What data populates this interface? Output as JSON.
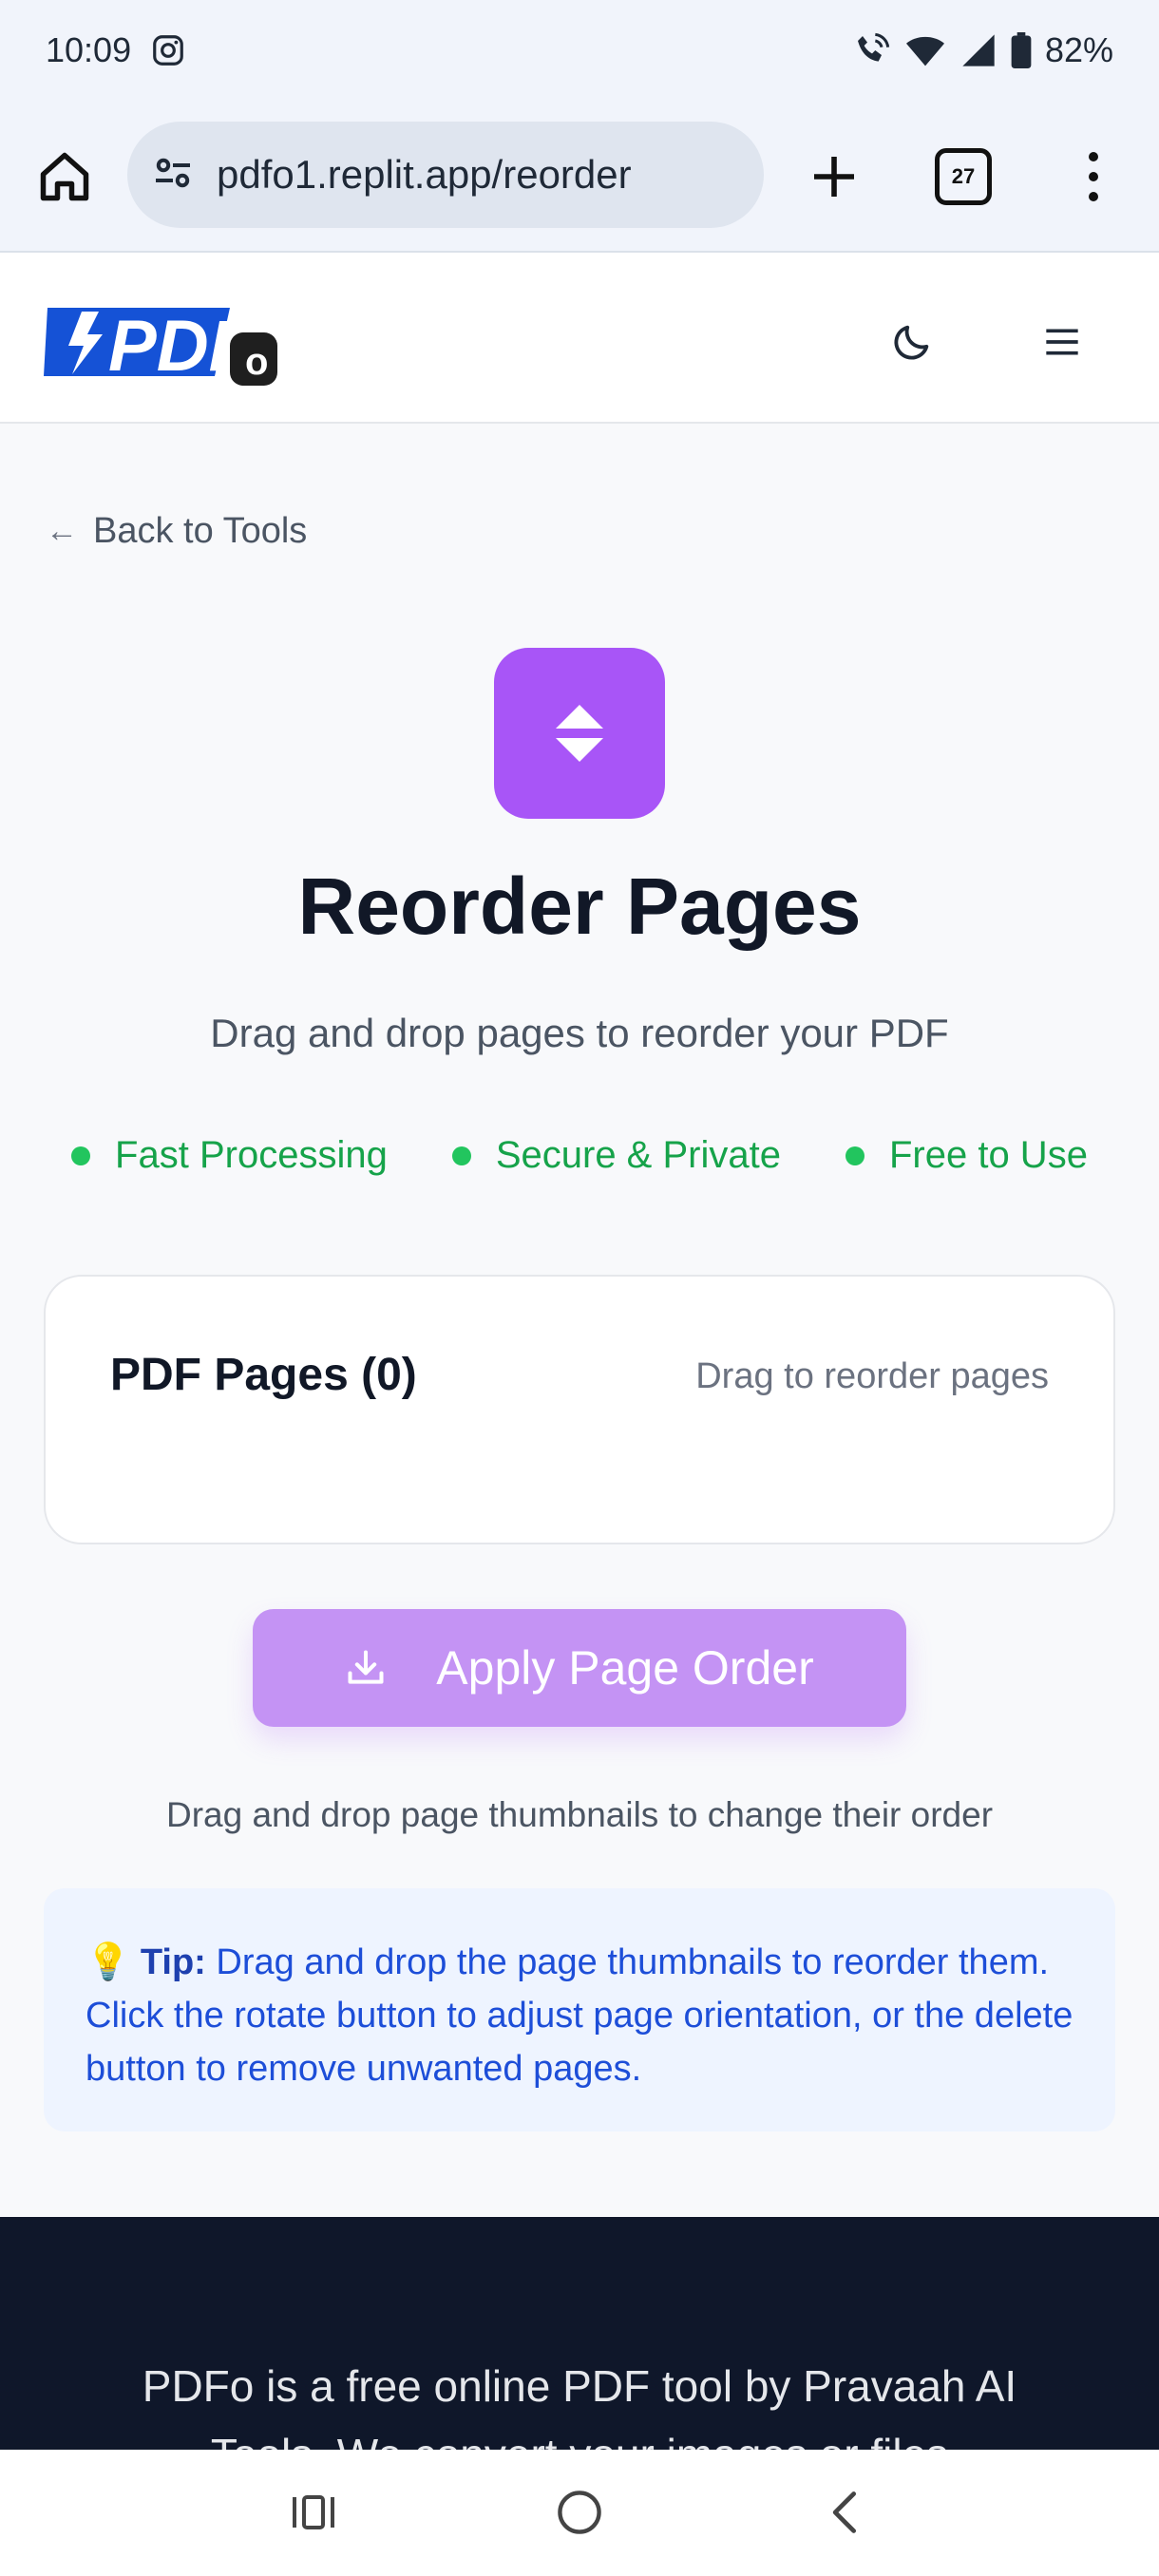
{
  "status_bar": {
    "time": "10:09",
    "battery": "82%",
    "icons": [
      "instagram-icon",
      "wifi-call-icon",
      "wifi-icon",
      "signal-icon",
      "battery-icon"
    ]
  },
  "browser": {
    "url": "pdfo1.replit.app/reorder",
    "tab_count": "27",
    "icons": [
      "home-icon",
      "site-settings-icon",
      "new-tab-icon",
      "tabs-icon",
      "more-icon"
    ]
  },
  "header": {
    "logo_text": "PDF",
    "logo_badge": "o",
    "icons": [
      "moon-icon",
      "menu-icon"
    ]
  },
  "main": {
    "back_link": "Back to Tools",
    "title": "Reorder Pages",
    "subtitle": "Drag and drop pages to reorder your PDF",
    "features": [
      "Fast Processing",
      "Secure & Private",
      "Free to Use"
    ],
    "pages_card": {
      "title": "PDF Pages (0)",
      "hint": "Drag to reorder pages"
    },
    "apply_button": "Apply Page Order",
    "apply_hint": "Drag and drop page thumbnails to change their order",
    "tip": {
      "emoji": "💡",
      "label": "Tip:",
      "text": "Drag and drop the page thumbnails to reorder them. Click the rotate button to adjust page orientation, or the delete button to remove unwanted pages."
    }
  },
  "footer": {
    "line1": "PDFo is a free online PDF tool by Pravaah AI",
    "line2": "Tools. We convert your images or files"
  },
  "colors": {
    "accent": "#a855f7",
    "button": "#c493f4",
    "feature_green": "#16a34a",
    "logo_blue": "#1552d6",
    "tip_blue": "#1d4ed8",
    "footer_bg": "#0f172a"
  }
}
